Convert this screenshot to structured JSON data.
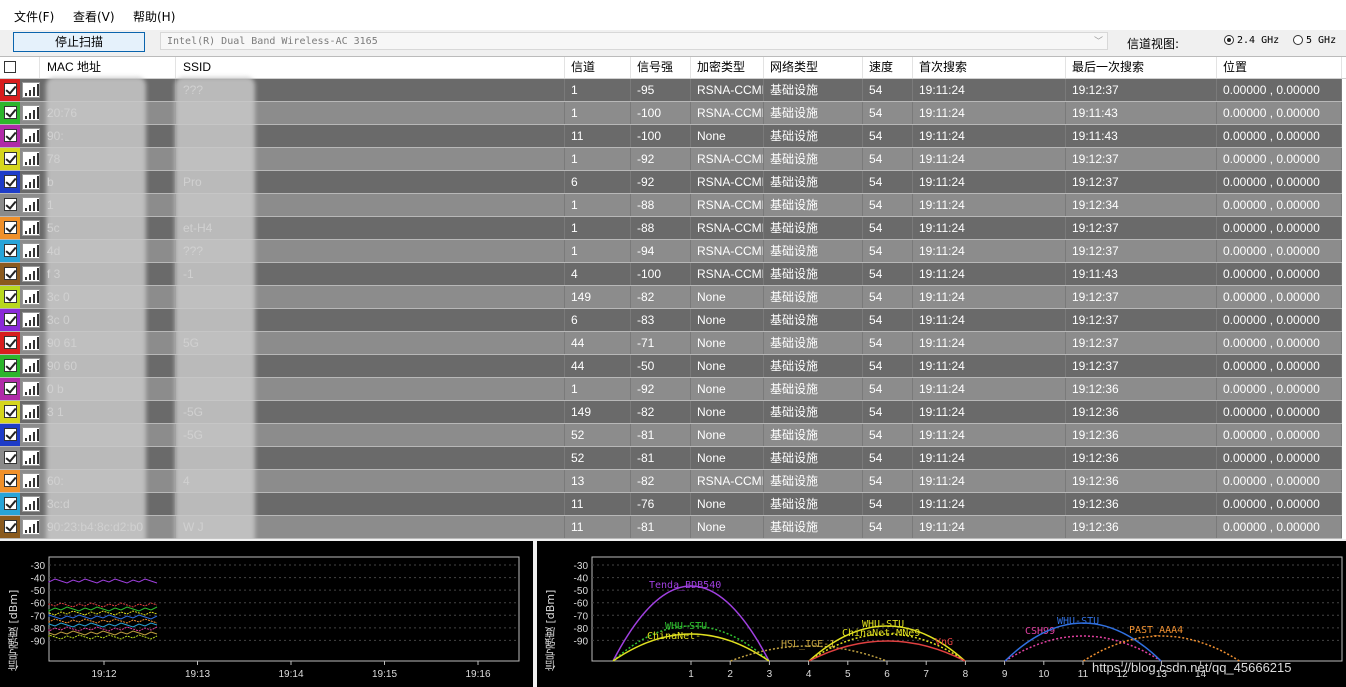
{
  "menu": {
    "file": "文件(F)",
    "view": "查看(V)",
    "help": "帮助(H)"
  },
  "toolbar": {
    "scan_button": "停止扫描",
    "adapter": "Intel(R) Dual Band Wireless-AC 3165",
    "channel_view_label": "信道视图:",
    "band_24": "2.4 GHz",
    "band_5": "5 GHz",
    "selected_band": "2.4 GHz"
  },
  "table": {
    "headers": [
      "MAC 地址",
      "SSID",
      "信道",
      "信号强",
      "加密类型",
      "网络类型",
      "速度",
      "首次搜索",
      "最后一次搜索",
      "位置"
    ],
    "rows": [
      {
        "color": "#d81e1e",
        "mac": "",
        "ssid": "???",
        "channel": "1",
        "signal": "-95",
        "enc": "RSNA-CCMP",
        "type": "基础设施",
        "speed": "54",
        "first": "19:11:24",
        "last": "19:12:37",
        "pos": "0.00000 , 0.00000"
      },
      {
        "color": "#2cb52c",
        "mac": "20:76",
        "ssid": "",
        "channel": "1",
        "signal": "-100",
        "enc": "RSNA-CCMP",
        "type": "基础设施",
        "speed": "54",
        "first": "19:11:24",
        "last": "19:11:43",
        "pos": "0.00000 , 0.00000"
      },
      {
        "color": "#b02aa8",
        "mac": "90:",
        "ssid": "",
        "channel": "11",
        "signal": "-100",
        "enc": "None",
        "type": "基础设施",
        "speed": "54",
        "first": "19:11:24",
        "last": "19:11:43",
        "pos": "0.00000 , 0.00000"
      },
      {
        "color": "#d6d61e",
        "mac": "78",
        "ssid": "",
        "channel": "1",
        "signal": "-92",
        "enc": "RSNA-CCMP",
        "type": "基础设施",
        "speed": "54",
        "first": "19:11:24",
        "last": "19:12:37",
        "pos": "0.00000 , 0.00000"
      },
      {
        "color": "#1e3cc8",
        "mac": "b",
        "ssid": "Pro",
        "channel": "6",
        "signal": "-92",
        "enc": "RSNA-CCMP",
        "type": "基础设施",
        "speed": "54",
        "first": "19:11:24",
        "last": "19:12:37",
        "pos": "0.00000 , 0.00000"
      },
      {
        "color": "#8a8a8a",
        "mac": "1",
        "ssid": "",
        "channel": "1",
        "signal": "-88",
        "enc": "RSNA-CCMP",
        "type": "基础设施",
        "speed": "54",
        "first": "19:11:24",
        "last": "19:12:34",
        "pos": "0.00000 , 0.00000"
      },
      {
        "color": "#f0902a",
        "mac": "5c",
        "ssid": "et-H4",
        "channel": "1",
        "signal": "-88",
        "enc": "RSNA-CCMP",
        "type": "基础设施",
        "speed": "54",
        "first": "19:11:24",
        "last": "19:12:37",
        "pos": "0.00000 , 0.00000"
      },
      {
        "color": "#28a4d8",
        "mac": "4d",
        "ssid": "???",
        "channel": "1",
        "signal": "-94",
        "enc": "RSNA-CCMP",
        "type": "基础设施",
        "speed": "54",
        "first": "19:11:24",
        "last": "19:12:37",
        "pos": "0.00000 , 0.00000"
      },
      {
        "color": "#8a5a1e",
        "mac": "f  3",
        "ssid": "-1",
        "channel": "4",
        "signal": "-100",
        "enc": "RSNA-CCMP",
        "type": "基础设施",
        "speed": "54",
        "first": "19:11:24",
        "last": "19:11:43",
        "pos": "0.00000 , 0.00000"
      },
      {
        "color": "#b8d81e",
        "mac": "3c  0",
        "ssid": "",
        "channel": "149",
        "signal": "-82",
        "enc": "None",
        "type": "基础设施",
        "speed": "54",
        "first": "19:11:24",
        "last": "19:12:37",
        "pos": "0.00000 , 0.00000"
      },
      {
        "color": "#8a2ad8",
        "mac": "3c  0",
        "ssid": "",
        "channel": "6",
        "signal": "-83",
        "enc": "None",
        "type": "基础设施",
        "speed": "54",
        "first": "19:11:24",
        "last": "19:12:37",
        "pos": "0.00000 , 0.00000"
      },
      {
        "color": "#d81e1e",
        "mac": "90  61",
        "ssid": "5G",
        "channel": "44",
        "signal": "-71",
        "enc": "None",
        "type": "基础设施",
        "speed": "54",
        "first": "19:11:24",
        "last": "19:12:37",
        "pos": "0.00000 , 0.00000"
      },
      {
        "color": "#2cb52c",
        "mac": "90  60",
        "ssid": "",
        "channel": "44",
        "signal": "-50",
        "enc": "None",
        "type": "基础设施",
        "speed": "54",
        "first": "19:11:24",
        "last": "19:12:37",
        "pos": "0.00000 , 0.00000"
      },
      {
        "color": "#b02aa8",
        "mac": "0  b",
        "ssid": "",
        "channel": "1",
        "signal": "-92",
        "enc": "None",
        "type": "基础设施",
        "speed": "54",
        "first": "19:11:24",
        "last": "19:12:36",
        "pos": "0.00000 , 0.00000"
      },
      {
        "color": "#d6d61e",
        "mac": "3  1",
        "ssid": "-5G",
        "channel": "149",
        "signal": "-82",
        "enc": "None",
        "type": "基础设施",
        "speed": "54",
        "first": "19:11:24",
        "last": "19:12:36",
        "pos": "0.00000 , 0.00000"
      },
      {
        "color": "#1e3cc8",
        "mac": "",
        "ssid": "-5G",
        "channel": "52",
        "signal": "-81",
        "enc": "None",
        "type": "基础设施",
        "speed": "54",
        "first": "19:11:24",
        "last": "19:12:36",
        "pos": "0.00000 , 0.00000"
      },
      {
        "color": "#8a8a8a",
        "mac": "",
        "ssid": "",
        "channel": "52",
        "signal": "-81",
        "enc": "None",
        "type": "基础设施",
        "speed": "54",
        "first": "19:11:24",
        "last": "19:12:36",
        "pos": "0.00000 , 0.00000"
      },
      {
        "color": "#f0902a",
        "mac": "60:",
        "ssid": "4",
        "channel": "13",
        "signal": "-82",
        "enc": "RSNA-CCMP",
        "type": "基础设施",
        "speed": "54",
        "first": "19:11:24",
        "last": "19:12:36",
        "pos": "0.00000 , 0.00000"
      },
      {
        "color": "#28a4d8",
        "mac": "3c:d",
        "ssid": "",
        "channel": "11",
        "signal": "-76",
        "enc": "None",
        "type": "基础设施",
        "speed": "54",
        "first": "19:11:24",
        "last": "19:12:36",
        "pos": "0.00000 , 0.00000"
      },
      {
        "color": "#8a5a1e",
        "mac": "90:23:b4:8c:d2:b0",
        "ssid": "W  J",
        "channel": "11",
        "signal": "-81",
        "enc": "None",
        "type": "基础设施",
        "speed": "54",
        "first": "19:11:24",
        "last": "19:12:36",
        "pos": "0.00000 , 0.00000"
      }
    ]
  },
  "time_chart": {
    "ylabel": "信号强度",
    "unit": "[dBm]",
    "yticks": [
      "-30",
      "-40",
      "-50",
      "-60",
      "-70",
      "-80",
      "-90"
    ],
    "xticks": [
      "19:12",
      "19:13",
      "19:14",
      "19:15",
      "19:16"
    ]
  },
  "channel_chart": {
    "ylabel": "信号强度",
    "unit": "[dBm]",
    "yticks": [
      "-30",
      "-40",
      "-50",
      "-60",
      "-70",
      "-80",
      "-90"
    ],
    "xticks": [
      "1",
      "2",
      "3",
      "4",
      "5",
      "6",
      "7",
      "8",
      "9",
      "10",
      "11",
      "12",
      "13",
      "14"
    ],
    "networks": [
      {
        "name": "Tenda_BDB540",
        "color": "#a040e0"
      },
      {
        "name": "WHU-STU",
        "color": "#30c030"
      },
      {
        "name": "ChinaNet-",
        "color": "#e0e020"
      },
      {
        "name": "HSL_IGE-1",
        "color": "#c0a040"
      },
      {
        "name": "WHU-STU",
        "color": "#e0e020"
      },
      {
        "name": "ChinaNet-MNe9",
        "color": "#e0e020"
      },
      {
        "name": "VnG",
        "color": "#e04040"
      },
      {
        "name": "CSH99",
        "color": "#e040a0"
      },
      {
        "name": "WHU-STU",
        "color": "#3070e0"
      },
      {
        "name": "PAST_AAA4",
        "color": "#f09030"
      }
    ]
  },
  "watermark": "https://blog.csdn.net/qq_45666215"
}
